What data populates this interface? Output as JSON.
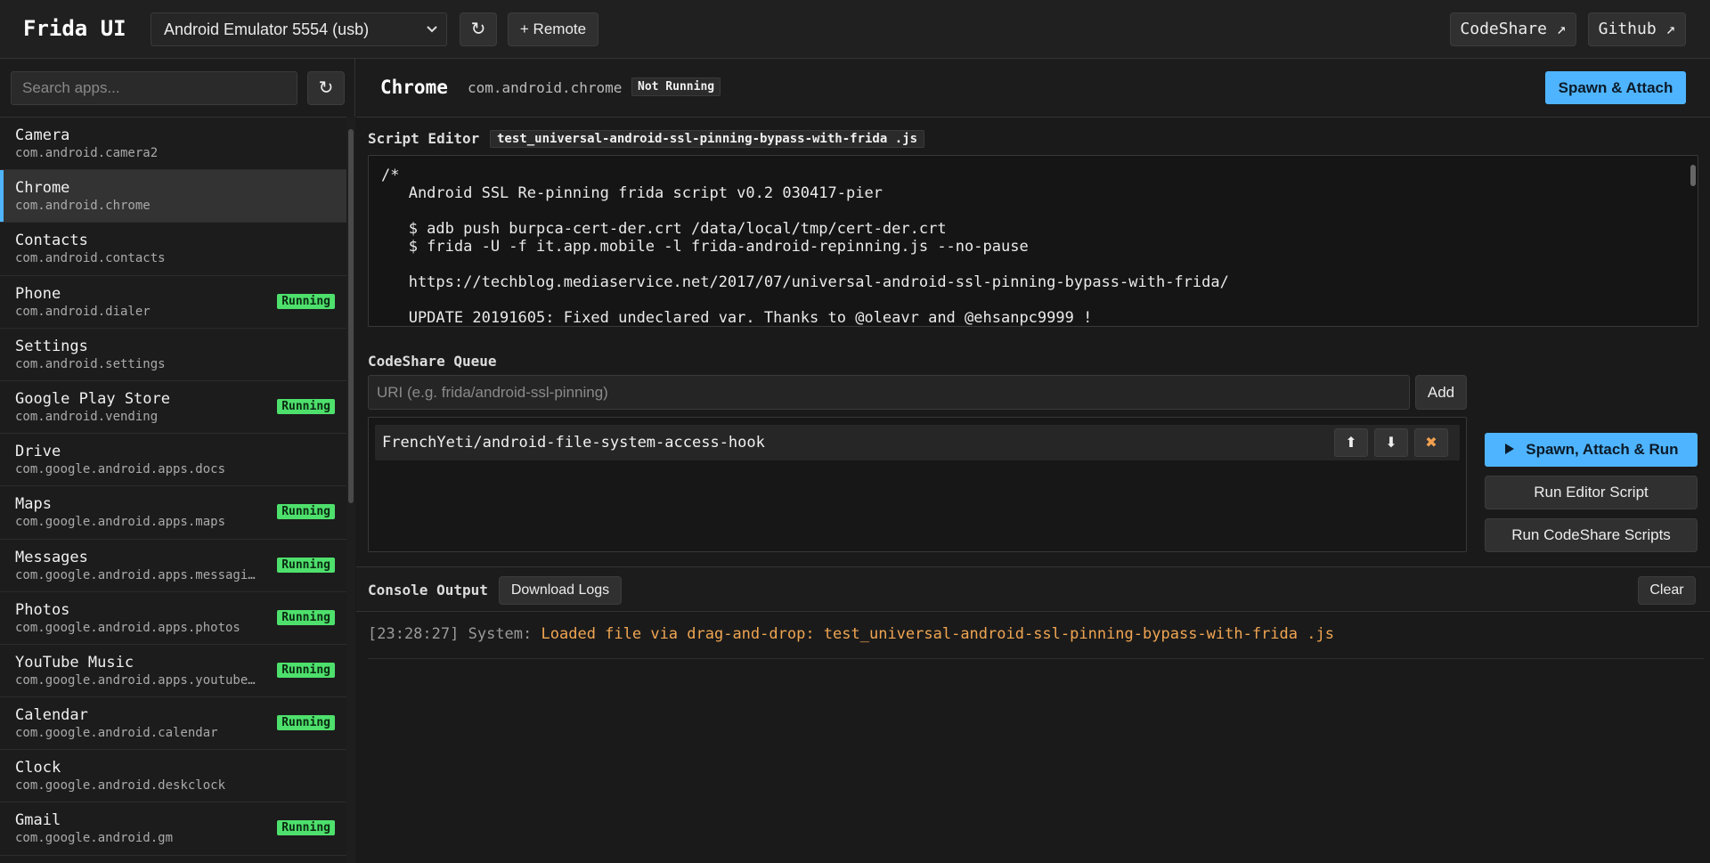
{
  "topbar": {
    "brand": "Frida UI",
    "device": "Android Emulator 5554 (usb)",
    "refresh_label": "↻",
    "remote_label": "+ Remote",
    "codeshare_label": "CodeShare ↗",
    "github_label": "Github ↗"
  },
  "sidebar": {
    "search_placeholder": "Search apps...",
    "refresh_label": "↻",
    "running_label": "Running",
    "apps": [
      {
        "name": "Camera",
        "pkg": "com.android.camera2",
        "running": false,
        "selected": false
      },
      {
        "name": "Chrome",
        "pkg": "com.android.chrome",
        "running": false,
        "selected": true
      },
      {
        "name": "Contacts",
        "pkg": "com.android.contacts",
        "running": false,
        "selected": false
      },
      {
        "name": "Phone",
        "pkg": "com.android.dialer",
        "running": true,
        "selected": false
      },
      {
        "name": "Settings",
        "pkg": "com.android.settings",
        "running": false,
        "selected": false
      },
      {
        "name": "Google Play Store",
        "pkg": "com.android.vending",
        "running": true,
        "selected": false
      },
      {
        "name": "Drive",
        "pkg": "com.google.android.apps.docs",
        "running": false,
        "selected": false
      },
      {
        "name": "Maps",
        "pkg": "com.google.android.apps.maps",
        "running": true,
        "selected": false
      },
      {
        "name": "Messages",
        "pkg": "com.google.android.apps.messaging",
        "running": true,
        "selected": false
      },
      {
        "name": "Photos",
        "pkg": "com.google.android.apps.photos",
        "running": true,
        "selected": false
      },
      {
        "name": "YouTube Music",
        "pkg": "com.google.android.apps.youtube.music",
        "running": true,
        "selected": false
      },
      {
        "name": "Calendar",
        "pkg": "com.google.android.calendar",
        "running": true,
        "selected": false
      },
      {
        "name": "Clock",
        "pkg": "com.google.android.deskclock",
        "running": false,
        "selected": false
      },
      {
        "name": "Gmail",
        "pkg": "com.google.android.gm",
        "running": true,
        "selected": false
      }
    ]
  },
  "main": {
    "app_title": "Chrome",
    "app_pkg": "com.android.chrome",
    "status": "Not Running",
    "spawn_attach_label": "Spawn & Attach",
    "editor_label": "Script Editor",
    "editor_file": "test_universal-android-ssl-pinning-bypass-with-frida .js",
    "editor_content": "/*\n   Android SSL Re-pinning frida script v0.2 030417-pier\n\n   $ adb push burpca-cert-der.crt /data/local/tmp/cert-der.crt\n   $ frida -U -f it.app.mobile -l frida-android-repinning.js --no-pause\n\n   https://techblog.mediaservice.net/2017/07/universal-android-ssl-pinning-bypass-with-frida/\n\n   UPDATE 20191605: Fixed undeclared var. Thanks to @oleavr and @ehsanpc9999 !",
    "queue_label": "CodeShare Queue",
    "uri_placeholder": "URI (e.g. frida/android-ssl-pinning)",
    "add_label": "Add",
    "queue_items": [
      {
        "name": "FrenchYeti/android-file-system-access-hook",
        "up": "⬆",
        "down": "⬇",
        "remove": "✖"
      }
    ],
    "run_all_label": "Spawn, Attach & Run",
    "run_editor_label": "Run Editor Script",
    "run_codeshare_label": "Run CodeShare Scripts"
  },
  "console": {
    "label": "Console Output",
    "download_label": "Download Logs",
    "clear_label": "Clear",
    "lines": [
      {
        "time": "[23:28:27]",
        "source": "System:",
        "message": "Loaded file via drag-and-drop: test_universal-android-ssl-pinning-bypass-with-frida .js"
      }
    ]
  }
}
